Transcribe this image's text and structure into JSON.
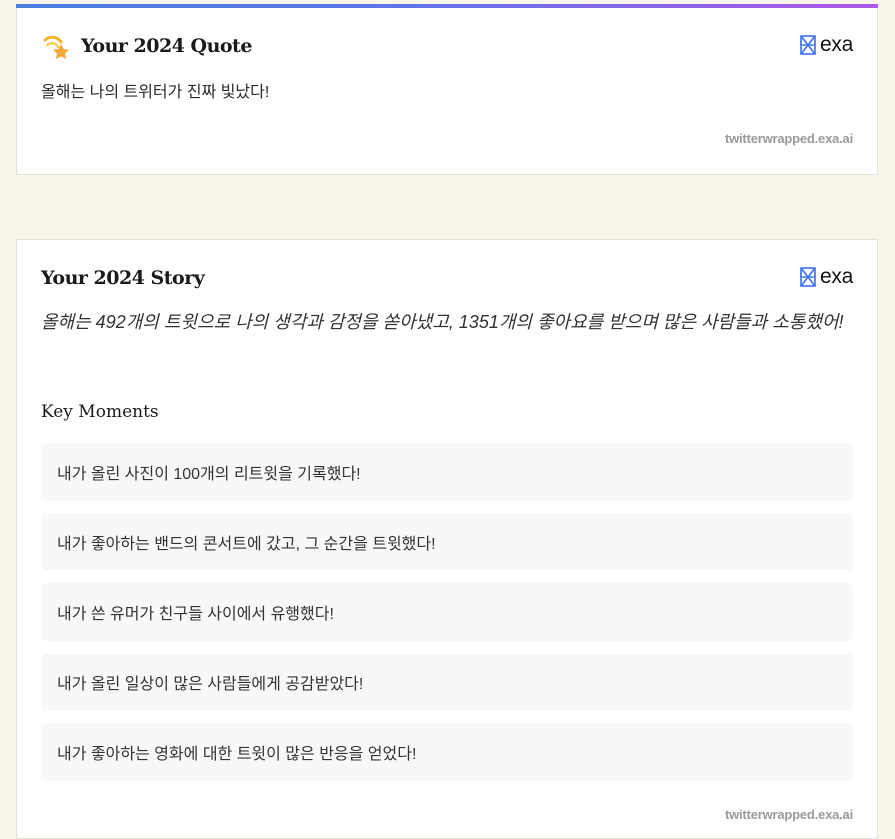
{
  "colors": {
    "page_background": "#f8f6ea",
    "card_background": "#ffffff",
    "accent_gradient": [
      "#4a7fe0",
      "#b05ae8"
    ],
    "moment_background": "#f8f8f8",
    "muted_text": "#9a9a9a",
    "brand_mark": "#3b6ff0"
  },
  "quote_card": {
    "icon": "shooting-star-icon",
    "title": "Your 2024 Quote",
    "brand_name": "exa",
    "quote": "올해는 나의 트위터가 진짜 빛났다!",
    "footer": "twitterwrapped.exa.ai"
  },
  "story_card": {
    "title": "Your 2024 Story",
    "brand_name": "exa",
    "summary": "올해는 492개의 트윗으로 나의 생각과 감정을 쏟아냈고, 1351개의 좋아요를 받으며 많은 사람들과 소통했어!",
    "key_moments_heading": "Key Moments",
    "key_moments": [
      "내가 올린 사진이 100개의 리트윗을 기록했다!",
      "내가 좋아하는 밴드의 콘서트에 갔고, 그 순간을 트윗했다!",
      "내가 쓴 유머가 친구들 사이에서 유행했다!",
      "내가 올린 일상이 많은 사람들에게 공감받았다!",
      "내가 좋아하는 영화에 대한 트윗이 많은 반응을 얻었다!"
    ],
    "footer": "twitterwrapped.exa.ai"
  }
}
